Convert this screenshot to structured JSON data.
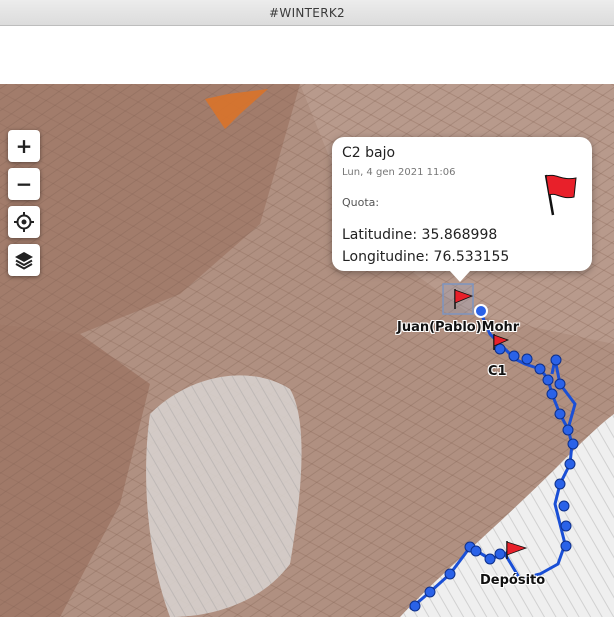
{
  "window": {
    "title": "#WINTERK2"
  },
  "controls": {
    "zoom_in": "+",
    "zoom_out": "−",
    "locate_icon": "crosshair-icon",
    "layers_icon": "layers-icon"
  },
  "popup": {
    "title": "C2 bajo",
    "date": "Lun, 4 gen 2021 11:06",
    "quota": "Quota:",
    "latitude": "Latitudine: 35.868998",
    "longitude": "Longitudine: 76.533155",
    "flag_icon": "red-flag-icon"
  },
  "labels": {
    "climber": "Juan(Pablo)Mohr",
    "c1": "C1",
    "deposito": "Depósito"
  },
  "colors": {
    "track": "#1a4fd6",
    "flag": "#e8202a",
    "terrain": "#a98877",
    "snow": "#e6e6e6"
  }
}
